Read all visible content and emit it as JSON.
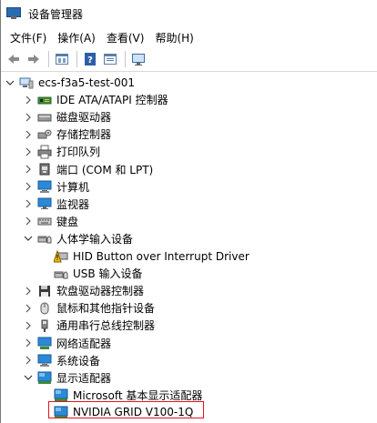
{
  "window": {
    "title": "设备管理器"
  },
  "menu": [
    {
      "label": "文件(F)"
    },
    {
      "label": "操作(A)"
    },
    {
      "label": "查看(V)"
    },
    {
      "label": "帮助(H)"
    }
  ],
  "toolbar": {
    "icons": [
      "back-arrow-icon",
      "forward-arrow-icon",
      "properties-icon",
      "help-icon",
      "properties-sheet-icon",
      "monitor-scan-icon"
    ]
  },
  "tree": {
    "root": {
      "label": "ecs-f3a5-test-001"
    },
    "items": [
      {
        "label": "IDE ATA/ATAPI 控制器",
        "expanded": false,
        "icon": "ide-controller-icon"
      },
      {
        "label": "磁盘驱动器",
        "expanded": false,
        "icon": "disk-drive-icon"
      },
      {
        "label": "存储控制器",
        "expanded": false,
        "icon": "storage-controller-icon"
      },
      {
        "label": "打印队列",
        "expanded": false,
        "icon": "printer-icon"
      },
      {
        "label": "端口 (COM 和 LPT)",
        "expanded": false,
        "icon": "port-icon"
      },
      {
        "label": "计算机",
        "expanded": false,
        "icon": "computer-icon"
      },
      {
        "label": "监视器",
        "expanded": false,
        "icon": "monitor-icon"
      },
      {
        "label": "键盘",
        "expanded": false,
        "icon": "keyboard-icon"
      },
      {
        "label": "人体学输入设备",
        "expanded": true,
        "icon": "hid-icon",
        "children": [
          {
            "label": "HID Button over Interrupt Driver",
            "icon": "warning-device-icon"
          },
          {
            "label": "USB 输入设备",
            "icon": "hid-device-icon"
          }
        ]
      },
      {
        "label": "软盘驱动器控制器",
        "expanded": false,
        "icon": "floppy-controller-icon"
      },
      {
        "label": "鼠标和其他指针设备",
        "expanded": false,
        "icon": "mouse-icon"
      },
      {
        "label": "通用串行总线控制器",
        "expanded": false,
        "icon": "usb-icon"
      },
      {
        "label": "网络适配器",
        "expanded": false,
        "icon": "network-adapter-icon"
      },
      {
        "label": "系统设备",
        "expanded": false,
        "icon": "system-device-icon"
      },
      {
        "label": "显示适配器",
        "expanded": true,
        "icon": "display-adapter-icon",
        "children": [
          {
            "label": "Microsoft 基本显示适配器",
            "icon": "display-adapter-icon"
          },
          {
            "label": "NVIDIA GRID V100-1Q",
            "icon": "display-adapter-icon"
          }
        ]
      }
    ]
  },
  "colors": {
    "highlight_border": "#e81123",
    "accent": "#2b6cb0"
  }
}
